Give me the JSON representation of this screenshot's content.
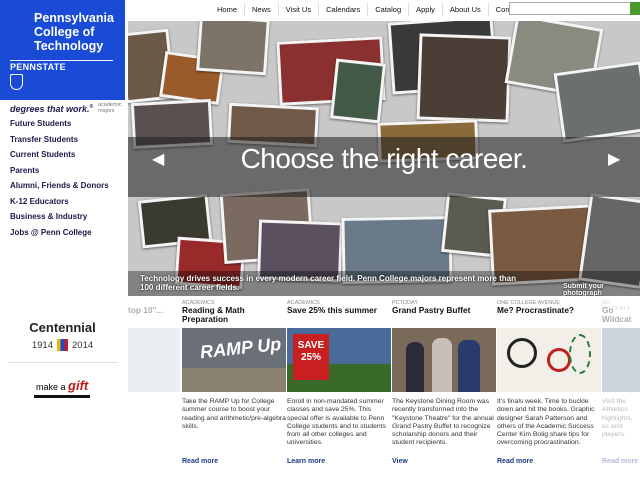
{
  "logo": {
    "line1": "Pennsylvania College of Technology",
    "brand": "PENNSTATE"
  },
  "tagline": {
    "text": "degrees that work.",
    "sub": "academic majors"
  },
  "sidebar": {
    "items": [
      {
        "label": "Future Students"
      },
      {
        "label": "Transfer Students"
      },
      {
        "label": "Current Students"
      },
      {
        "label": "Parents"
      },
      {
        "label": "Alumni, Friends & Donors"
      },
      {
        "label": "K-12 Educators"
      },
      {
        "label": "Business & Industry"
      },
      {
        "label": "Jobs @ Penn College"
      }
    ]
  },
  "centennial": {
    "title": "Centennial",
    "start": "1914",
    "end": "2014"
  },
  "gift": {
    "pre": "make a",
    "word": "gift"
  },
  "topnav": {
    "items": [
      "Home",
      "News",
      "Visit Us",
      "Calendars",
      "Catalog",
      "Apply",
      "About Us",
      "Contact Us"
    ]
  },
  "search": {
    "placeholder": ""
  },
  "hero": {
    "title": "Choose the right career.",
    "caption": "Technology drives success in every modern career field. Penn College majors represent more than 100 different career fields.",
    "submit": "Submit your photograph",
    "prev": "◀",
    "next": "▶"
  },
  "tiles": [
    {
      "cat": "",
      "title": "top 10\"...",
      "text": "",
      "more": ""
    },
    {
      "cat": "ACADEMICS",
      "title": "Reading & Math Preparation",
      "text": "Take the RAMP Up for College summer course to boost your reading and arithmetic/pre-algebra skills.",
      "more": "Read more",
      "img_text": "RAMP Up"
    },
    {
      "cat": "ACADEMICS",
      "title": "Save 25% this summer",
      "text": "Enroll in non-mandated summer classes and save 25%. This special offer is available to Penn College students and to students from all other colleges and universities.",
      "more": "Learn more",
      "img_text": "SAVE 25%"
    },
    {
      "cat": "PCTODAY",
      "title": "Grand Pastry Buffet",
      "text": "The Keystone Dining Room was recently transformed into the \"Keystone Theatre\" for the annual Grand Pastry Buffet to recognize scholarship donors and their student recipients.",
      "more": "View"
    },
    {
      "cat": "ONE COLLEGE AVENUE",
      "title": "Me? Procrastinate?",
      "text": "It's finals week. Time to buckle down and hit the books. Graphic designer Sarah Patterson and others of the Academic Success Center Kim Bolig share tips for overcoming procrastination.",
      "more": "Read more"
    },
    {
      "cat": "GO WILDCATS",
      "title": "Go Wildcat",
      "text": "Visit the Athletics highlights, sc and players.",
      "more": "Read more"
    }
  ],
  "colors": {
    "brand_blue": "#1a4bd6",
    "link": "#1a3a8a",
    "gift_red": "#c01818",
    "go_green": "#4a9b2c"
  }
}
